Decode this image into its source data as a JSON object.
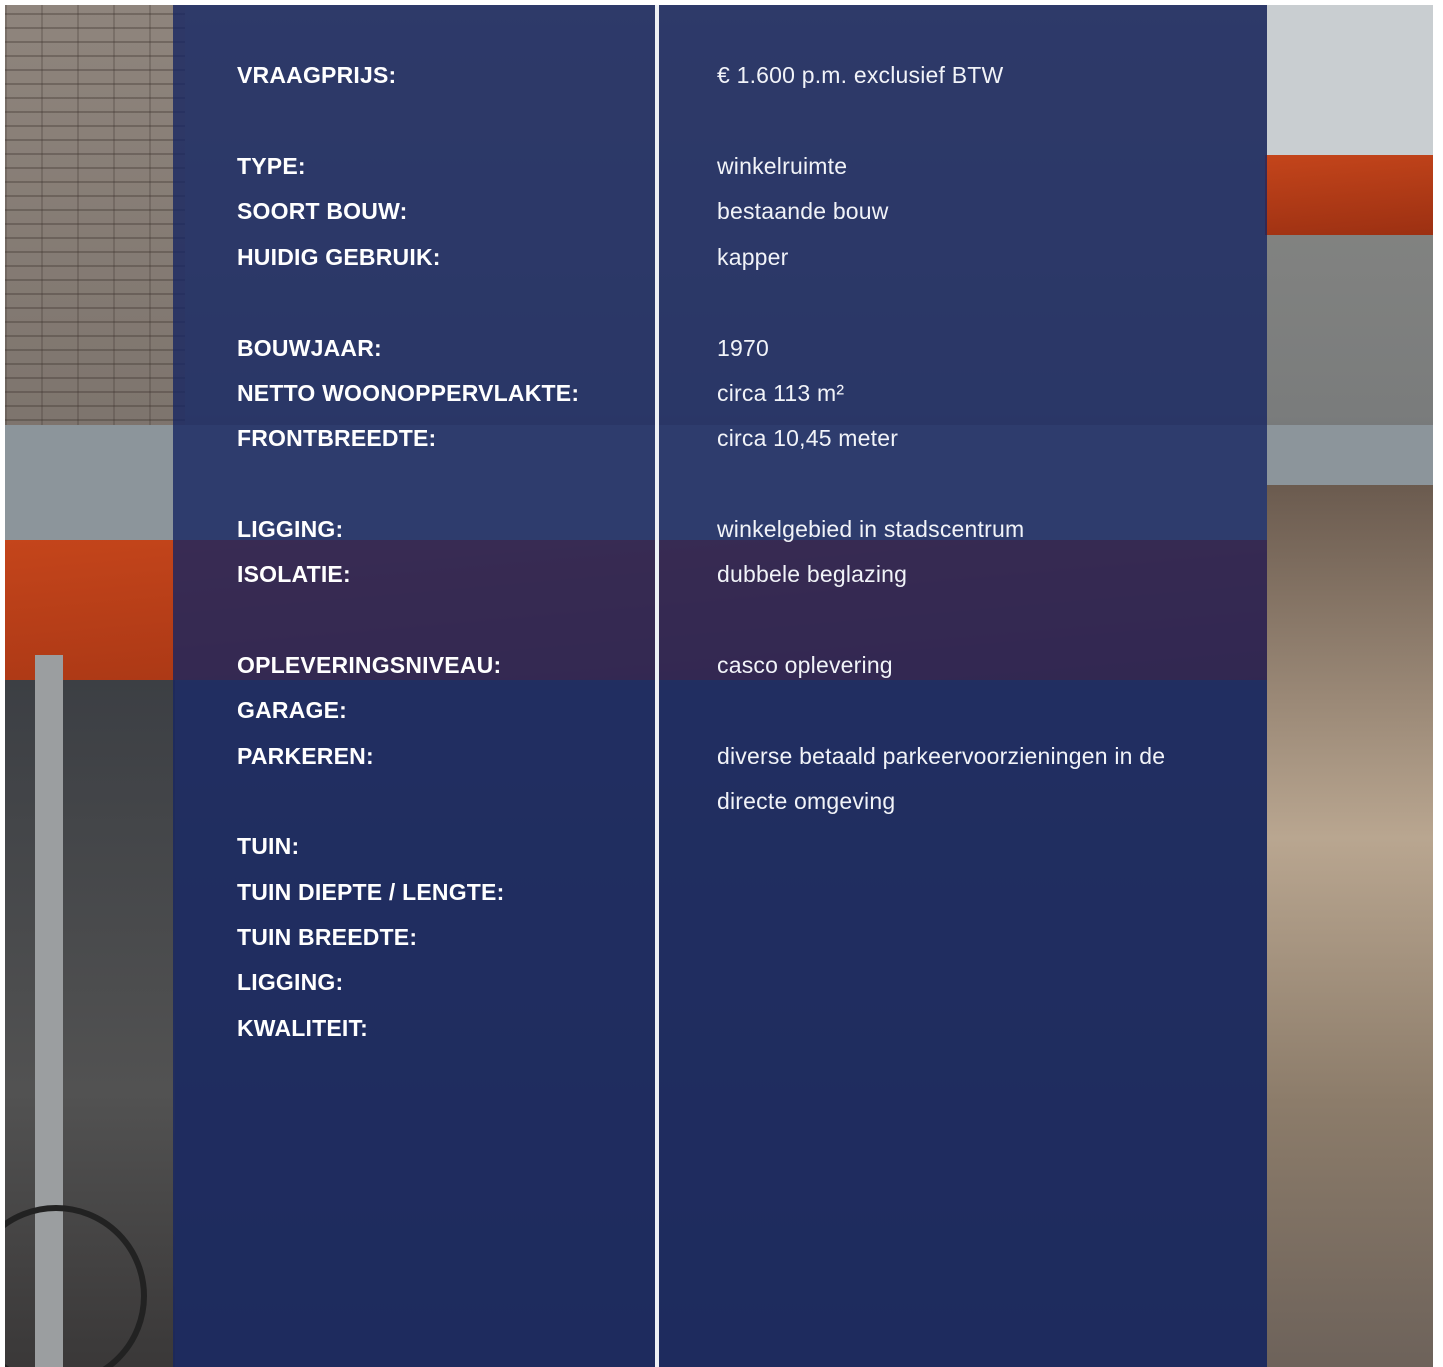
{
  "specs": [
    {
      "label": "VRAAGPRIJS:",
      "value": "€ 1.600 p.m. exclusief BTW"
    },
    {
      "label": "TYPE:",
      "value": "winkelruimte"
    },
    {
      "label": "SOORT BOUW:",
      "value": "bestaande bouw"
    },
    {
      "label": "HUIDIG GEBRUIK:",
      "value": "kapper"
    },
    {
      "label": "BOUWJAAR:",
      "value": "1970"
    },
    {
      "label": "NETTO WOONOPPERVLAKTE:",
      "value": "circa 113 m²"
    },
    {
      "label": "FRONTBREEDTE:",
      "value": "circa 10,45 meter"
    },
    {
      "label": "LIGGING:",
      "value": "winkelgebied in stadscentrum"
    },
    {
      "label": "ISOLATIE:",
      "value": "dubbele beglazing"
    },
    {
      "label": "OPLEVERINGSNIVEAU:",
      "value": "casco oplevering"
    },
    {
      "label": "GARAGE:",
      "value": ""
    },
    {
      "label": "PARKEREN:",
      "value": "diverse betaald parkeervoorzieningen in de directe omgeving"
    },
    {
      "label": "TUIN:",
      "value": ""
    },
    {
      "label": "TUIN DIEPTE / LENGTE:",
      "value": ""
    },
    {
      "label": "TUIN BREEDTE:",
      "value": ""
    },
    {
      "label": "LIGGING:",
      "value": ""
    },
    {
      "label": "KWALITEIT:",
      "value": ""
    }
  ],
  "colors": {
    "overlay": "#162661",
    "text": "#ffffff",
    "divider": "#eef0f4"
  }
}
